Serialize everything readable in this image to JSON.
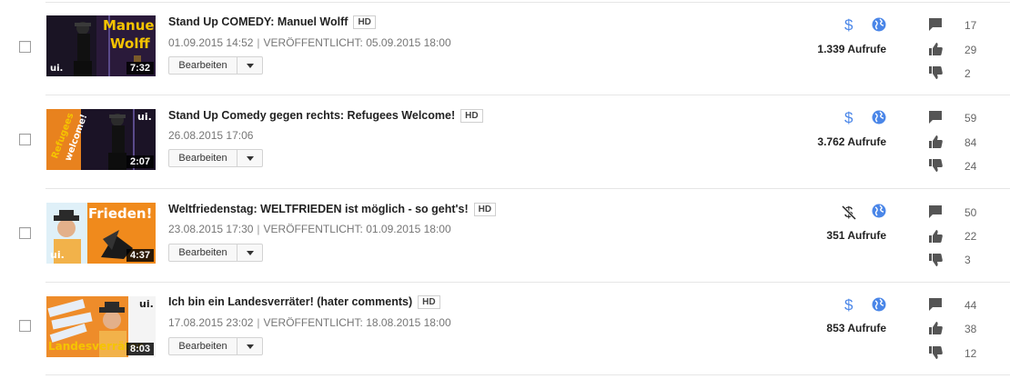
{
  "videos": [
    {
      "title": "Stand Up COMEDY: Manuel Wolff",
      "hd": "HD",
      "uploaded": "01.09.2015 14:52",
      "published": "VERÖFFENTLICHT: 05.09.2015 18:00",
      "duration": "7:32",
      "thumb_text": [
        "Manuel",
        "Wolff"
      ],
      "thumb_logo": "ui.",
      "edit_label": "Bearbeiten",
      "monetization": "dollar-icon",
      "visibility": "globe-icon",
      "views": "1.339 Aufrufe",
      "comments": "17",
      "likes": "29",
      "dislikes": "2"
    },
    {
      "title": "Stand Up Comedy gegen rechts: Refugees Welcome!",
      "hd": "HD",
      "uploaded": "26.08.2015 17:06",
      "published": "",
      "duration": "2:07",
      "thumb_text": [
        "Refugees",
        "welcome!"
      ],
      "thumb_logo": "ui.",
      "edit_label": "Bearbeiten",
      "monetization": "dollar-icon",
      "visibility": "globe-icon",
      "views": "3.762 Aufrufe",
      "comments": "59",
      "likes": "84",
      "dislikes": "24"
    },
    {
      "title": "Weltfriedenstag: WELTFRIEDEN ist möglich - so geht's!",
      "hd": "HD",
      "uploaded": "23.08.2015 17:30",
      "published": "VERÖFFENTLICHT: 01.09.2015 18:00",
      "duration": "4:37",
      "thumb_text": [
        "Frieden!"
      ],
      "thumb_logo": "ui.",
      "edit_label": "Bearbeiten",
      "monetization": "dollar-off-icon",
      "visibility": "globe-icon",
      "views": "351 Aufrufe",
      "comments": "50",
      "likes": "22",
      "dislikes": "3"
    },
    {
      "title": "Ich bin ein Landesverräter! (hater comments)",
      "hd": "HD",
      "uploaded": "17.08.2015 23:02",
      "published": "VERÖFFENTLICHT: 18.08.2015 18:00",
      "duration": "8:03",
      "thumb_text": [
        "Landesverräter"
      ],
      "thumb_logo": "ui.",
      "edit_label": "Bearbeiten",
      "monetization": "dollar-icon",
      "visibility": "globe-icon",
      "views": "853 Aufrufe",
      "comments": "44",
      "likes": "38",
      "dislikes": "12"
    }
  ],
  "colors": {
    "accent_blue": "#4a86e8",
    "thumb_orange": "#e8821e",
    "thumb_yellow": "#f5c400",
    "icon_gray": "#555555"
  }
}
